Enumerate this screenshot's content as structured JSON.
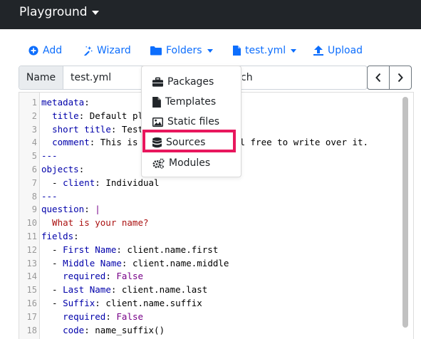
{
  "brand": {
    "label": "Playground"
  },
  "toolbar": {
    "add": "Add",
    "wizard": "Wizard",
    "folders": "Folders",
    "file": "test.yml",
    "upload": "Upload"
  },
  "name_bar": {
    "label": "Name",
    "value": "test.yml",
    "search_fragment": "arch"
  },
  "dropdown": {
    "items": [
      "Packages",
      "Templates",
      "Static files",
      "Sources",
      "Modules"
    ],
    "highlighted": "Sources"
  },
  "colors": {
    "accent": "#0d6efd",
    "navbar": "#212529",
    "highlight": "#e8175d"
  },
  "editor": {
    "lines": [
      {
        "n": "1",
        "t": "metadata:"
      },
      {
        "n": "2",
        "t": "  title: Default pl"
      },
      {
        "n": "3",
        "t": "  short title: Test"
      },
      {
        "n": "4",
        "t": "  comment: This is                Feel free to write over it."
      },
      {
        "n": "5",
        "t": "---"
      },
      {
        "n": "6",
        "t": "objects:"
      },
      {
        "n": "7",
        "t": "  - client: Individual"
      },
      {
        "n": "8",
        "t": "---"
      },
      {
        "n": "9",
        "t": "question: |"
      },
      {
        "n": "10",
        "t": "  What is your name?"
      },
      {
        "n": "11",
        "t": "fields:"
      },
      {
        "n": "12",
        "t": "  - First Name: client.name.first"
      },
      {
        "n": "13",
        "t": "  - Middle Name: client.name.middle"
      },
      {
        "n": "14",
        "t": "    required: False"
      },
      {
        "n": "15",
        "t": "  - Last Name: client.name.last"
      },
      {
        "n": "16",
        "t": "  - Suffix: client.name.suffix"
      },
      {
        "n": "17",
        "t": "    required: False"
      },
      {
        "n": "18",
        "t": "    code: name_suffix()"
      }
    ]
  }
}
